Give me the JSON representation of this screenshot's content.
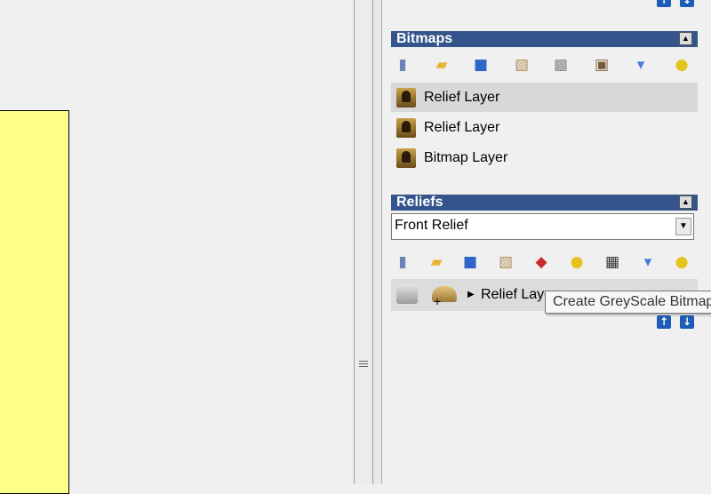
{
  "bitmaps": {
    "title": "Bitmaps",
    "layers": [
      {
        "name": "Relief Layer",
        "selected": true
      },
      {
        "name": "Relief Layer",
        "selected": false
      },
      {
        "name": "Bitmap Layer",
        "selected": false
      }
    ]
  },
  "reliefs": {
    "title": "Reliefs",
    "dropdown_value": "Front Relief",
    "layer_name": "Relief Layer"
  },
  "tooltip": "Create GreyScale Bitmap",
  "icons": {
    "new": "new-file-icon",
    "open": "open-folder-icon",
    "save": "save-icon",
    "lightbulb": "lightbulb-icon",
    "delete": "bucket-icon",
    "up": "up-arrow-icon",
    "down": "down-arrow-icon"
  },
  "colors": {
    "header_bg": "#34558b",
    "sheet_yellow": "#ffff88",
    "arrow_blue": "#1c5bb8"
  }
}
